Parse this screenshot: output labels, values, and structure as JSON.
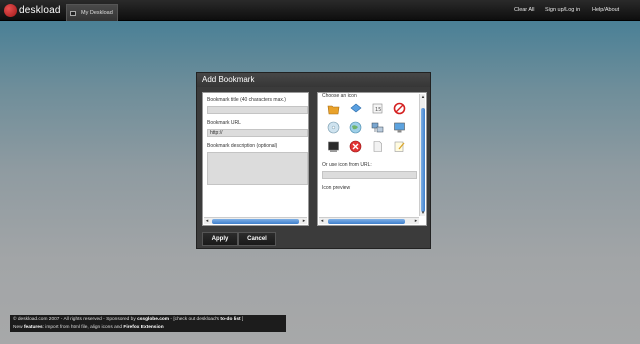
{
  "topbar": {
    "logo_text": "deskload",
    "tab_label": "My Deskload",
    "nav": [
      "Clear All",
      "Sign up/Log in",
      "Help/About"
    ]
  },
  "dialog": {
    "title": "Add Bookmark",
    "bookmark_title_label": "Bookmark title (40 characters max.)",
    "bookmark_title_value": "",
    "bookmark_url_label": "Bookmark URL",
    "bookmark_url_value": "http://",
    "bookmark_description_label": "Bookmark description (optional)",
    "bookmark_description_value": "",
    "choose_icon_label": "Choose an icon",
    "icon_url_label": "Or use icon from URL:",
    "icon_url_value": "",
    "icon_preview_label": "Icon preview",
    "apply_label": "Apply",
    "cancel_label": "Cancel",
    "icons": [
      "folder-icon",
      "tag-icon",
      "calendar-icon",
      "no-entry-icon",
      "cd-icon",
      "globe-icon",
      "network-icon",
      "monitor-icon",
      "terminal-icon",
      "close-red-icon",
      "document-icon",
      "notepad-icon"
    ]
  },
  "footer": {
    "line1_a": "© deskload.com 2007 - All rights reserved - Sponsored by",
    "sponsor": "cssglobe.com",
    "line1_b": "- [check out deskload's",
    "todo": "to-do list",
    "line1_c": "]",
    "line2_a": "New",
    "features": "features",
    "line2_b": ": import from html file, align icons and",
    "firefox": "Firefox Extension"
  },
  "colors": {
    "accent_blue": "#3f7fcc",
    "logo_red": "#c62828"
  }
}
